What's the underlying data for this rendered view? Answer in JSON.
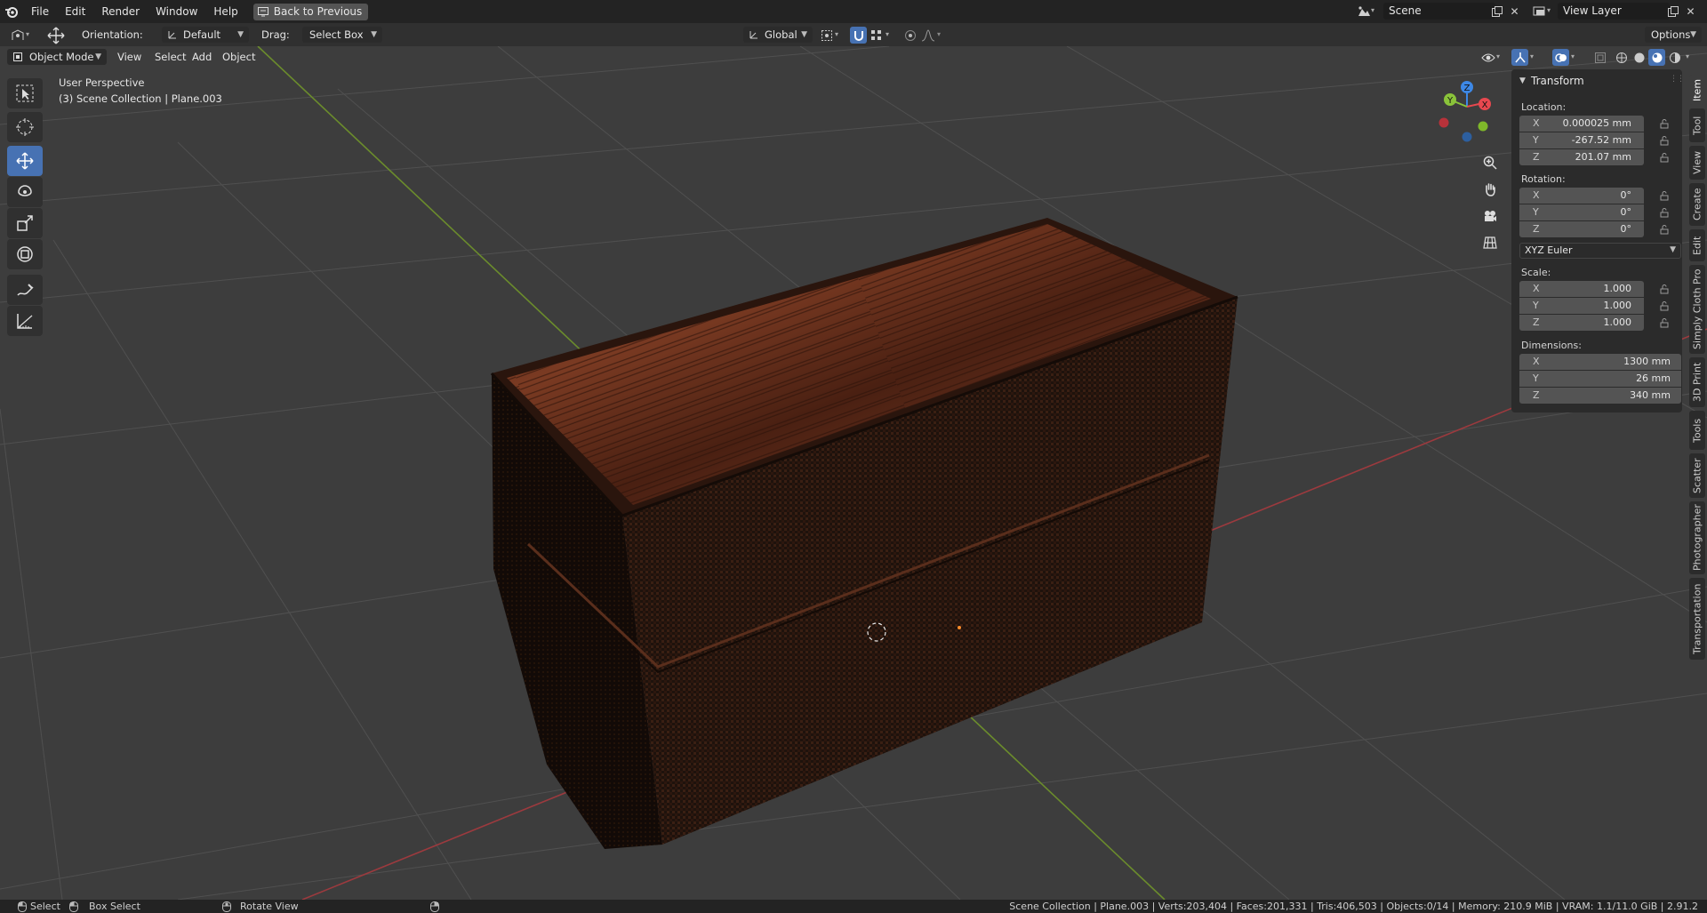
{
  "menu": {
    "items": [
      "File",
      "Edit",
      "Render",
      "Window",
      "Help"
    ],
    "back_button": "Back to Previous"
  },
  "scene": {
    "name": "Scene"
  },
  "view_layer": {
    "name": "View Layer"
  },
  "tool_header": {
    "orientation_label": "Orientation:",
    "orientation_value": "Default",
    "drag_label": "Drag:",
    "drag_value": "Select Box",
    "transform_orientation": "Global",
    "options_label": "Options"
  },
  "viewport_header": {
    "mode": "Object Mode",
    "view": "View",
    "select": "Select",
    "add": "Add",
    "object": "Object"
  },
  "viewport_overlay": {
    "perspective": "User Perspective",
    "collection": "(3) Scene Collection | Plane.003"
  },
  "gizmo": {
    "x": "X",
    "y": "Y",
    "z": "Z"
  },
  "transform": {
    "title": "Transform",
    "location_label": "Location:",
    "location": {
      "x": "0.000025 mm",
      "y": "-267.52 mm",
      "z": "201.07 mm"
    },
    "rotation_label": "Rotation:",
    "rotation": {
      "x": "0°",
      "y": "0°",
      "z": "0°"
    },
    "rotation_mode": "XYZ Euler",
    "scale_label": "Scale:",
    "scale": {
      "x": "1.000",
      "y": "1.000",
      "z": "1.000"
    },
    "dimensions_label": "Dimensions:",
    "dimensions": {
      "x": "1300 mm",
      "y": "26 mm",
      "z": "340 mm"
    },
    "axis_labels": {
      "x": "X",
      "y": "Y",
      "z": "Z"
    }
  },
  "side_tabs": [
    "Item",
    "Tool",
    "View",
    "Create",
    "Edit",
    "Simply Cloth Pro",
    "3D Print",
    "Tools",
    "Scatter",
    "Photographer",
    "Transportation"
  ],
  "status": {
    "select": "Select",
    "box_select": "Box Select",
    "rotate_view": "Rotate View",
    "info": "Scene Collection | Plane.003 | Verts:203,404 | Faces:201,331 | Tris:406,503 | Objects:0/14 | Memory: 210.9 MiB | VRAM: 1.1/11.0 GiB | 2.91.2"
  },
  "colors": {
    "accent": "#4772b3",
    "axis_x": "#e8484f",
    "axis_y": "#8ac33a",
    "axis_z": "#3d88e6"
  }
}
